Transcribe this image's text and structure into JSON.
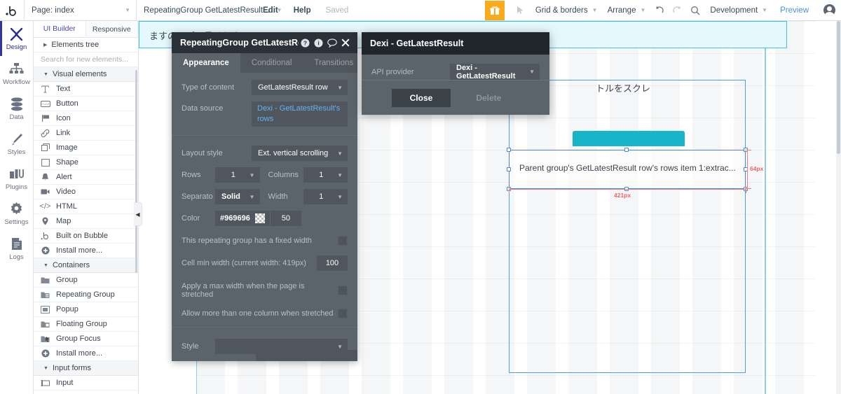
{
  "topbar": {
    "logo": "bubble-logo",
    "page_selector": {
      "label": "Page: index",
      "icon": "chevron-down-icon"
    },
    "element_selector": {
      "label": "RepeatingGroup GetLatestResult...",
      "icon": "chevron-down-icon"
    },
    "edit": "Edit",
    "help": "Help",
    "save_status": "Saved",
    "gift_icon": "gift-icon",
    "pointer_icon": "cursor-arrow-icon",
    "grid_borders": "Grid & borders",
    "arrange": "Arrange",
    "undo_icon": "undo-icon",
    "redo_icon": "redo-icon",
    "search_icon": "search-icon",
    "version": "Development",
    "preview": "Preview",
    "avatar": "user-avatar-icon"
  },
  "rail": {
    "items": [
      {
        "label": "Design",
        "icon": "design-icon",
        "active": true
      },
      {
        "label": "Workflow",
        "icon": "workflow-icon",
        "active": false
      },
      {
        "label": "Data",
        "icon": "database-icon",
        "active": false
      },
      {
        "label": "Styles",
        "icon": "paintbrush-icon",
        "active": false
      },
      {
        "label": "Plugins",
        "icon": "plugins-icon",
        "active": false
      },
      {
        "label": "Settings",
        "icon": "gear-icon",
        "active": false
      },
      {
        "label": "Logs",
        "icon": "logs-icon",
        "active": false
      }
    ]
  },
  "elements_panel": {
    "tabs": [
      {
        "label": "UI Builder",
        "active": true
      },
      {
        "label": "Responsive",
        "active": false
      }
    ],
    "tree_label": "Elements tree",
    "search_placeholder": "Search for new elements...",
    "sections": [
      {
        "title": "Visual elements",
        "items": [
          {
            "label": "Text",
            "icon": "text-icon"
          },
          {
            "label": "Button",
            "icon": "button-icon"
          },
          {
            "label": "Icon",
            "icon": "flag-icon"
          },
          {
            "label": "Link",
            "icon": "link-icon"
          },
          {
            "label": "Image",
            "icon": "image-icon"
          },
          {
            "label": "Shape",
            "icon": "shape-icon"
          },
          {
            "label": "Alert",
            "icon": "bell-icon"
          },
          {
            "label": "Video",
            "icon": "video-icon"
          },
          {
            "label": "HTML",
            "icon": "code-icon"
          },
          {
            "label": "Map",
            "icon": "map-pin-icon"
          },
          {
            "label": "Built on Bubble",
            "icon": "bubble-icon"
          },
          {
            "label": "Install more...",
            "icon": "plus-circle-icon"
          }
        ]
      },
      {
        "title": "Containers",
        "items": [
          {
            "label": "Group",
            "icon": "folder-icon"
          },
          {
            "label": "Repeating Group",
            "icon": "repeating-group-icon"
          },
          {
            "label": "Popup",
            "icon": "popup-icon"
          },
          {
            "label": "Floating Group",
            "icon": "floating-group-icon"
          },
          {
            "label": "Group Focus",
            "icon": "group-focus-icon"
          },
          {
            "label": "Install more...",
            "icon": "plus-circle-icon"
          }
        ]
      },
      {
        "title": "Input forms",
        "items": [
          {
            "label": "Input",
            "icon": "input-icon"
          }
        ]
      }
    ]
  },
  "property_panel": {
    "title": "RepeatingGroup GetLatestResult",
    "header_icons": [
      {
        "name": "help-icon",
        "glyph": "?"
      },
      {
        "name": "info-icon",
        "glyph": "i"
      },
      {
        "name": "comment-icon",
        "glyph": "○"
      },
      {
        "name": "close-icon",
        "glyph": "✕"
      }
    ],
    "tabs": [
      {
        "label": "Appearance",
        "active": true
      },
      {
        "label": "Conditional",
        "active": false
      },
      {
        "label": "Transitions",
        "active": false
      }
    ],
    "type_of_content": {
      "label": "Type of content",
      "value": "GetLatestResult row"
    },
    "data_source": {
      "label": "Data source",
      "value": "Dexi - GetLatestResult's rows"
    },
    "layout_style": {
      "label": "Layout style",
      "value": "Ext. vertical scrolling"
    },
    "rows": {
      "label": "Rows",
      "value": "1"
    },
    "columns": {
      "label": "Columns",
      "value": "1"
    },
    "separator": {
      "label": "Separato",
      "value": "Solid"
    },
    "sep_width": {
      "label": "Width",
      "value": "1"
    },
    "color": {
      "label": "Color",
      "value": "#969696",
      "opacity": "50"
    },
    "fixed_width": {
      "label": "This repeating group has a fixed width",
      "checked": false
    },
    "cell_min_width": {
      "label": "Cell min width (current width: 419px)",
      "value": "100"
    },
    "max_width": {
      "label": "Apply a max width when the page is stretched",
      "checked": false
    },
    "multi_column": {
      "label": "Allow more than one column when stretched",
      "checked": false
    },
    "style": {
      "label": "Style",
      "value": ""
    }
  },
  "dexi_dialog": {
    "title": "Dexi - GetLatestResult",
    "api_provider": {
      "label": "API provider",
      "value": "Dexi - GetLatestResult"
    },
    "close_button": "Close",
    "delete_button": "Delete"
  },
  "canvas": {
    "banner_text": "ますのでご了承ください。",
    "canvas_text": "トルをスクレ",
    "selected_element_text": "Parent group's GetLatestResult row's rows item 1:extrac...",
    "height_label": "64px",
    "width_label": "421px"
  },
  "colors": {
    "accent_blue": "#4a8fe0",
    "panel_dark": "#5b636b",
    "titlebar_dark": "#2b3138",
    "teal": "#18b5c8",
    "banner_bg": "#e4f8fd",
    "banner_border": "#3fc2dd",
    "dimension_red": "#ef7d7d",
    "gift_orange": "#f9ab1e"
  }
}
